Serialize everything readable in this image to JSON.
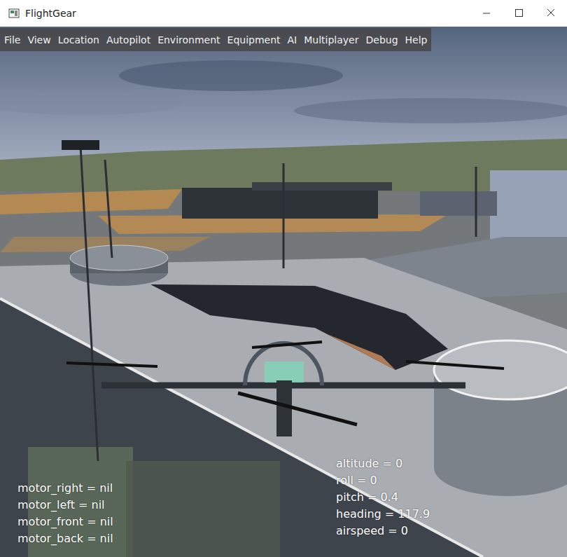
{
  "window": {
    "title": "FlightGear"
  },
  "menu": [
    {
      "label": "File"
    },
    {
      "label": "View"
    },
    {
      "label": "Location"
    },
    {
      "label": "Autopilot"
    },
    {
      "label": "Environment"
    },
    {
      "label": "Equipment"
    },
    {
      "label": "AI"
    },
    {
      "label": "Multiplayer"
    },
    {
      "label": "Debug"
    },
    {
      "label": "Help"
    }
  ],
  "motors": [
    {
      "label": "motor_right = nil"
    },
    {
      "label": "motor_left = nil"
    },
    {
      "label": "motor_front = nil"
    },
    {
      "label": "motor_back = nil"
    }
  ],
  "telemetry": [
    {
      "label": "altitude = 0"
    },
    {
      "label": "roll = 0"
    },
    {
      "label": "pitch = 0.4"
    },
    {
      "label": "heading = 117.9"
    },
    {
      "label": "airspeed = 0"
    }
  ]
}
